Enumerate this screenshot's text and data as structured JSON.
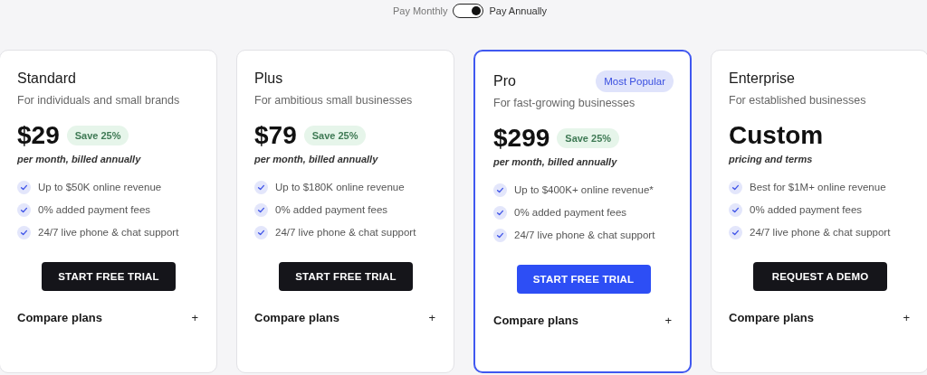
{
  "billing_toggle": {
    "left_label": "Pay Monthly",
    "right_label": "Pay Annually",
    "on": true
  },
  "plans": [
    {
      "name": "Standard",
      "featured": false,
      "tagline": "For individuals and small brands",
      "price": "$29",
      "save": "Save 25%",
      "price_note": "per month, billed annually",
      "features": [
        "Up to $50K online revenue",
        "0% added payment fees",
        "24/7 live phone & chat support"
      ],
      "button": {
        "label": "START FREE TRIAL",
        "kind": "dark"
      },
      "compare": "Compare plans",
      "compare_icon": "+"
    },
    {
      "name": "Plus",
      "featured": false,
      "tagline": "For ambitious small businesses",
      "price": "$79",
      "save": "Save 25%",
      "price_note": "per month, billed annually",
      "features": [
        "Up to $180K online revenue",
        "0% added payment fees",
        "24/7 live phone & chat support"
      ],
      "button": {
        "label": "START FREE TRIAL",
        "kind": "dark"
      },
      "compare": "Compare plans",
      "compare_icon": "+"
    },
    {
      "name": "Pro",
      "featured": true,
      "badge": "Most Popular",
      "tagline": "For fast-growing businesses",
      "price": "$299",
      "save": "Save 25%",
      "price_note": "per month, billed annually",
      "features": [
        "Up to $400K+ online revenue*",
        "0% added payment fees",
        "24/7 live phone & chat support"
      ],
      "button": {
        "label": "START FREE TRIAL",
        "kind": "primary"
      },
      "compare": "Compare plans",
      "compare_icon": "+"
    },
    {
      "name": "Enterprise",
      "featured": false,
      "tagline": "For established businesses",
      "price": "Custom",
      "price_note": "pricing and terms",
      "features": [
        "Best for $1M+ online revenue",
        "0% added payment fees",
        "24/7 live phone & chat support"
      ],
      "button": {
        "label": "REQUEST A DEMO",
        "kind": "dark"
      },
      "compare": "Compare plans",
      "compare_icon": "+"
    }
  ]
}
